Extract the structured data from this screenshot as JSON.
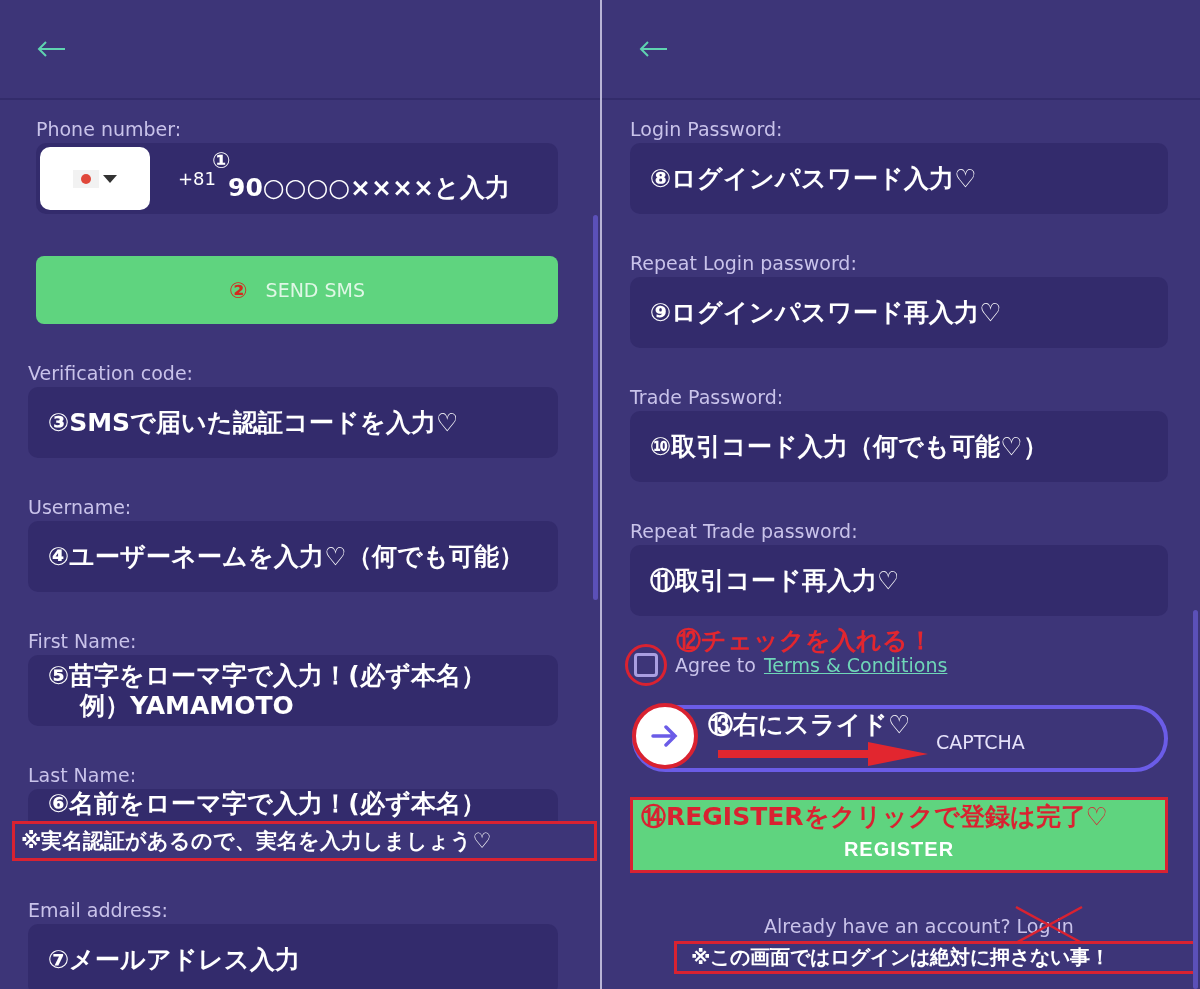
{
  "left": {
    "phone": {
      "label": "Phone number:",
      "code": "+81",
      "step": "①",
      "note": "90○○○○××××と入力"
    },
    "send_button": {
      "step": "②",
      "label": "SEND SMS"
    },
    "fields": [
      {
        "label": "Verification code:",
        "note": "③SMSで届いた認証コードを入力♡"
      },
      {
        "label": "Username:",
        "note": "④ユーザーネームを入力♡（何でも可能）"
      },
      {
        "label": "First Name:",
        "note": "⑤苗字をローマ字で入力！(必ず本名）",
        "note_2": "例）YAMAMOTO"
      },
      {
        "label": "Last Name:",
        "note": "⑥名前をローマ字で入力！(必ず本名）",
        "warning": "※実名認証があるので、実名を入力しましょう♡"
      },
      {
        "label": "Email address:",
        "note": "⑦メールアドレス入力"
      }
    ]
  },
  "right": {
    "fields": [
      {
        "label": "Login Password:",
        "note": "⑧ログインパスワード入力♡"
      },
      {
        "label": "Repeat Login password:",
        "note": "⑨ログインパスワード再入力♡"
      },
      {
        "label": "Trade Password:",
        "note": "⑩取引コード入力（何でも可能♡）"
      },
      {
        "label": "Repeat Trade password:",
        "note": "⑪取引コード再入力♡"
      }
    ],
    "agree": {
      "checked": false,
      "note": "⑫チェックを入れる！",
      "text": "Agree to",
      "link": "Terms & Conditions"
    },
    "captcha": {
      "note": "⑬右にスライド♡",
      "label": "CAPTCHA",
      "level": 0
    },
    "register": {
      "note": "⑭REGISTERをクリックで登録は完了♡",
      "label": "REGISTER"
    },
    "footer": {
      "text": "Already have an account?",
      "link": "Log in",
      "warning": "※この画面ではログインは絶対に押さない事！"
    }
  }
}
